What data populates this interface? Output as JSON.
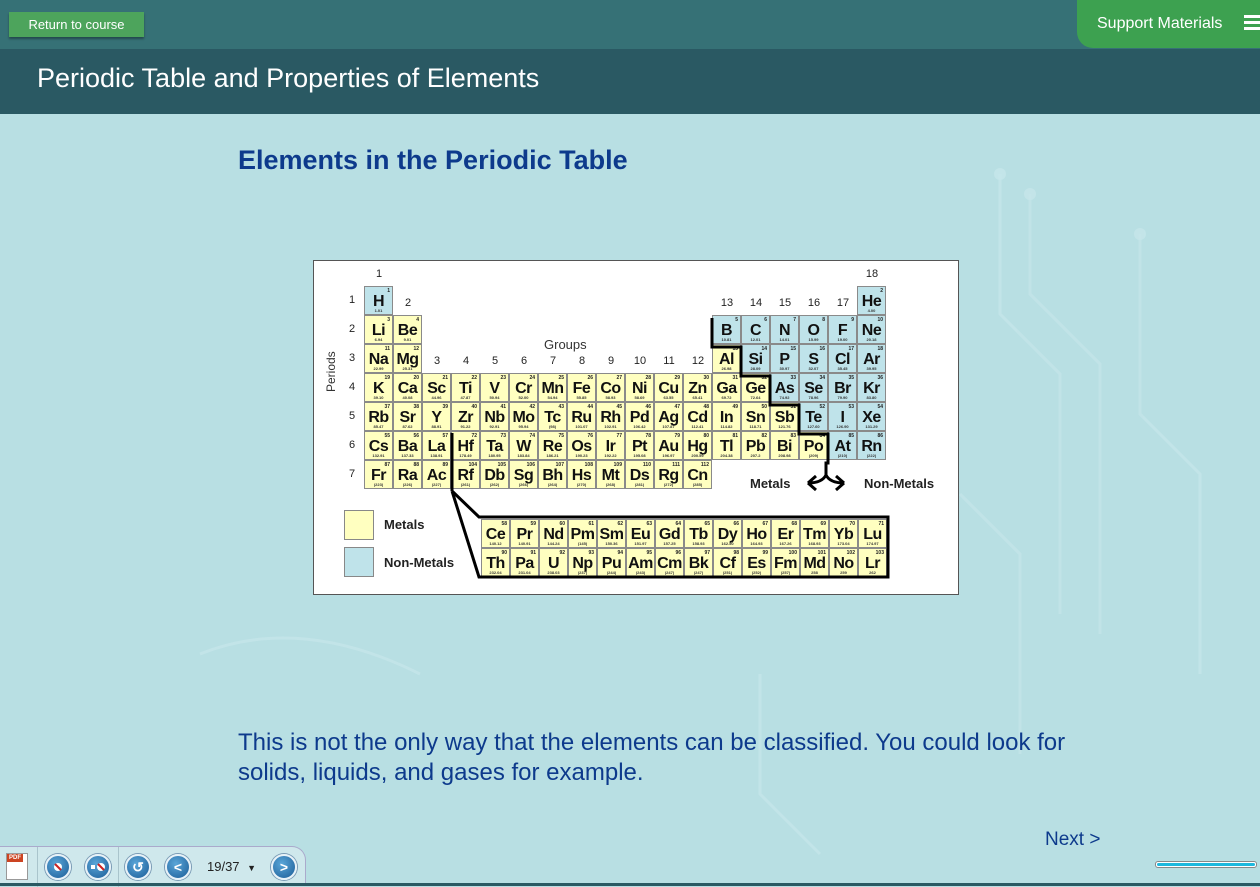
{
  "topbar": {
    "return_label": "Return to course",
    "support_label": "Support Materials"
  },
  "title": "Periodic Table and Properties of Elements",
  "heading": "Elements in the Periodic Table",
  "figure": {
    "groups_label": "Groups",
    "periods_label": "Periods",
    "group_labels": [
      "1",
      "2",
      "3",
      "4",
      "5",
      "6",
      "7",
      "8",
      "9",
      "10",
      "11",
      "12",
      "13",
      "14",
      "15",
      "16",
      "17",
      "18"
    ],
    "period_labels": [
      "1",
      "2",
      "3",
      "4",
      "5",
      "6",
      "7"
    ],
    "legend": [
      {
        "label": "Metals",
        "color": "#ffffc0"
      },
      {
        "label": "Non-Metals",
        "color": "#bfe3ea"
      }
    ],
    "divider_labels": {
      "left": "Metals",
      "right": "Non-Metals"
    },
    "elements": [
      {
        "s": "H",
        "n": 1,
        "m": "1.01",
        "r": 1,
        "c": 1,
        "t": "n"
      },
      {
        "s": "He",
        "n": 2,
        "m": "4.00",
        "r": 1,
        "c": 18,
        "t": "n"
      },
      {
        "s": "Li",
        "n": 3,
        "m": "6.94",
        "r": 2,
        "c": 1,
        "t": "m"
      },
      {
        "s": "Be",
        "n": 4,
        "m": "9.01",
        "r": 2,
        "c": 2,
        "t": "m"
      },
      {
        "s": "B",
        "n": 5,
        "m": "10.81",
        "r": 2,
        "c": 13,
        "t": "n"
      },
      {
        "s": "C",
        "n": 6,
        "m": "12.01",
        "r": 2,
        "c": 14,
        "t": "n"
      },
      {
        "s": "N",
        "n": 7,
        "m": "14.01",
        "r": 2,
        "c": 15,
        "t": "n"
      },
      {
        "s": "O",
        "n": 8,
        "m": "15.99",
        "r": 2,
        "c": 16,
        "t": "n"
      },
      {
        "s": "F",
        "n": 9,
        "m": "19.00",
        "r": 2,
        "c": 17,
        "t": "n"
      },
      {
        "s": "Ne",
        "n": 10,
        "m": "20.18",
        "r": 2,
        "c": 18,
        "t": "n"
      },
      {
        "s": "Na",
        "n": 11,
        "m": "22.99",
        "r": 3,
        "c": 1,
        "t": "m"
      },
      {
        "s": "Mg",
        "n": 12,
        "m": "25.31",
        "r": 3,
        "c": 2,
        "t": "m"
      },
      {
        "s": "Al",
        "n": 13,
        "m": "26.98",
        "r": 3,
        "c": 13,
        "t": "m"
      },
      {
        "s": "Si",
        "n": 14,
        "m": "28.09",
        "r": 3,
        "c": 14,
        "t": "n"
      },
      {
        "s": "P",
        "n": 15,
        "m": "30.97",
        "r": 3,
        "c": 15,
        "t": "n"
      },
      {
        "s": "S",
        "n": 16,
        "m": "32.07",
        "r": 3,
        "c": 16,
        "t": "n"
      },
      {
        "s": "Cl",
        "n": 17,
        "m": "35.45",
        "r": 3,
        "c": 17,
        "t": "n"
      },
      {
        "s": "Ar",
        "n": 18,
        "m": "39.95",
        "r": 3,
        "c": 18,
        "t": "n"
      },
      {
        "s": "K",
        "n": 19,
        "m": "39.10",
        "r": 4,
        "c": 1,
        "t": "m"
      },
      {
        "s": "Ca",
        "n": 20,
        "m": "40.08",
        "r": 4,
        "c": 2,
        "t": "m"
      },
      {
        "s": "Sc",
        "n": 21,
        "m": "44.96",
        "r": 4,
        "c": 3,
        "t": "m"
      },
      {
        "s": "Ti",
        "n": 22,
        "m": "47.87",
        "r": 4,
        "c": 4,
        "t": "m"
      },
      {
        "s": "V",
        "n": 23,
        "m": "50.94",
        "r": 4,
        "c": 5,
        "t": "m"
      },
      {
        "s": "Cr",
        "n": 24,
        "m": "52.00",
        "r": 4,
        "c": 6,
        "t": "m"
      },
      {
        "s": "Mn",
        "n": 25,
        "m": "54.94",
        "r": 4,
        "c": 7,
        "t": "m"
      },
      {
        "s": "Fe",
        "n": 26,
        "m": "55.85",
        "r": 4,
        "c": 8,
        "t": "m"
      },
      {
        "s": "Co",
        "n": 27,
        "m": "58.93",
        "r": 4,
        "c": 9,
        "t": "m"
      },
      {
        "s": "Ni",
        "n": 28,
        "m": "58.69",
        "r": 4,
        "c": 10,
        "t": "m"
      },
      {
        "s": "Cu",
        "n": 29,
        "m": "63.55",
        "r": 4,
        "c": 11,
        "t": "m"
      },
      {
        "s": "Zn",
        "n": 30,
        "m": "65.41",
        "r": 4,
        "c": 12,
        "t": "m"
      },
      {
        "s": "Ga",
        "n": 31,
        "m": "69.72",
        "r": 4,
        "c": 13,
        "t": "m"
      },
      {
        "s": "Ge",
        "n": 32,
        "m": "72.64",
        "r": 4,
        "c": 14,
        "t": "m"
      },
      {
        "s": "As",
        "n": 33,
        "m": "74.92",
        "r": 4,
        "c": 15,
        "t": "n"
      },
      {
        "s": "Se",
        "n": 34,
        "m": "78.96",
        "r": 4,
        "c": 16,
        "t": "n"
      },
      {
        "s": "Br",
        "n": 35,
        "m": "79.90",
        "r": 4,
        "c": 17,
        "t": "n"
      },
      {
        "s": "Kr",
        "n": 36,
        "m": "83.80",
        "r": 4,
        "c": 18,
        "t": "n"
      },
      {
        "s": "Rb",
        "n": 37,
        "m": "85.47",
        "r": 5,
        "c": 1,
        "t": "m"
      },
      {
        "s": "Sr",
        "n": 38,
        "m": "87.62",
        "r": 5,
        "c": 2,
        "t": "m"
      },
      {
        "s": "Y",
        "n": 39,
        "m": "88.91",
        "r": 5,
        "c": 3,
        "t": "m"
      },
      {
        "s": "Zr",
        "n": 40,
        "m": "91.22",
        "r": 5,
        "c": 4,
        "t": "m"
      },
      {
        "s": "Nb",
        "n": 41,
        "m": "92.91",
        "r": 5,
        "c": 5,
        "t": "m"
      },
      {
        "s": "Mo",
        "n": 42,
        "m": "95.94",
        "r": 5,
        "c": 6,
        "t": "m"
      },
      {
        "s": "Tc",
        "n": 43,
        "m": "(98)",
        "r": 5,
        "c": 7,
        "t": "m"
      },
      {
        "s": "Ru",
        "n": 44,
        "m": "101.07",
        "r": 5,
        "c": 8,
        "t": "m"
      },
      {
        "s": "Rh",
        "n": 45,
        "m": "102.91",
        "r": 5,
        "c": 9,
        "t": "m"
      },
      {
        "s": "Pd",
        "n": 46,
        "m": "106.42",
        "r": 5,
        "c": 10,
        "t": "m"
      },
      {
        "s": "Ag",
        "n": 47,
        "m": "107.87",
        "r": 5,
        "c": 11,
        "t": "m"
      },
      {
        "s": "Cd",
        "n": 48,
        "m": "112.41",
        "r": 5,
        "c": 12,
        "t": "m"
      },
      {
        "s": "In",
        "n": 49,
        "m": "114.82",
        "r": 5,
        "c": 13,
        "t": "m"
      },
      {
        "s": "Sn",
        "n": 50,
        "m": "118.71",
        "r": 5,
        "c": 14,
        "t": "m"
      },
      {
        "s": "Sb",
        "n": 51,
        "m": "121.76",
        "r": 5,
        "c": 15,
        "t": "m"
      },
      {
        "s": "Te",
        "n": 52,
        "m": "127.60",
        "r": 5,
        "c": 16,
        "t": "n"
      },
      {
        "s": "I",
        "n": 53,
        "m": "126.90",
        "r": 5,
        "c": 17,
        "t": "n"
      },
      {
        "s": "Xe",
        "n": 54,
        "m": "131.29",
        "r": 5,
        "c": 18,
        "t": "n"
      },
      {
        "s": "Cs",
        "n": 55,
        "m": "132.91",
        "r": 6,
        "c": 1,
        "t": "m"
      },
      {
        "s": "Ba",
        "n": 56,
        "m": "137.33",
        "r": 6,
        "c": 2,
        "t": "m"
      },
      {
        "s": "La",
        "n": 57,
        "m": "138.91",
        "r": 6,
        "c": 3,
        "t": "m"
      },
      {
        "s": "Hf",
        "n": 72,
        "m": "178.49",
        "r": 6,
        "c": 4,
        "t": "m"
      },
      {
        "s": "Ta",
        "n": 73,
        "m": "180.95",
        "r": 6,
        "c": 5,
        "t": "m"
      },
      {
        "s": "W",
        "n": 74,
        "m": "183.84",
        "r": 6,
        "c": 6,
        "t": "m"
      },
      {
        "s": "Re",
        "n": 75,
        "m": "186.21",
        "r": 6,
        "c": 7,
        "t": "m"
      },
      {
        "s": "Os",
        "n": 76,
        "m": "190.23",
        "r": 6,
        "c": 8,
        "t": "m"
      },
      {
        "s": "Ir",
        "n": 77,
        "m": "192.22",
        "r": 6,
        "c": 9,
        "t": "m"
      },
      {
        "s": "Pt",
        "n": 78,
        "m": "195.08",
        "r": 6,
        "c": 10,
        "t": "m"
      },
      {
        "s": "Au",
        "n": 79,
        "m": "196.97",
        "r": 6,
        "c": 11,
        "t": "m"
      },
      {
        "s": "Hg",
        "n": 80,
        "m": "200.59",
        "r": 6,
        "c": 12,
        "t": "m"
      },
      {
        "s": "Tl",
        "n": 81,
        "m": "204.38",
        "r": 6,
        "c": 13,
        "t": "m"
      },
      {
        "s": "Pb",
        "n": 82,
        "m": "207.2",
        "r": 6,
        "c": 14,
        "t": "m"
      },
      {
        "s": "Bi",
        "n": 83,
        "m": "208.98",
        "r": 6,
        "c": 15,
        "t": "m"
      },
      {
        "s": "Po",
        "n": 84,
        "m": "(209)",
        "r": 6,
        "c": 16,
        "t": "m"
      },
      {
        "s": "At",
        "n": 85,
        "m": "(210)",
        "r": 6,
        "c": 17,
        "t": "n"
      },
      {
        "s": "Rn",
        "n": 86,
        "m": "(222)",
        "r": 6,
        "c": 18,
        "t": "n"
      },
      {
        "s": "Fr",
        "n": 87,
        "m": "(223)",
        "r": 7,
        "c": 1,
        "t": "m"
      },
      {
        "s": "Ra",
        "n": 88,
        "m": "(226)",
        "r": 7,
        "c": 2,
        "t": "m"
      },
      {
        "s": "Ac",
        "n": 89,
        "m": "(227)",
        "r": 7,
        "c": 3,
        "t": "m"
      },
      {
        "s": "Rf",
        "n": 104,
        "m": "(261)",
        "r": 7,
        "c": 4,
        "t": "m"
      },
      {
        "s": "Db",
        "n": 105,
        "m": "(262)",
        "r": 7,
        "c": 5,
        "t": "m"
      },
      {
        "s": "Sg",
        "n": 106,
        "m": "(266)",
        "r": 7,
        "c": 6,
        "t": "m"
      },
      {
        "s": "Bh",
        "n": 107,
        "m": "(264)",
        "r": 7,
        "c": 7,
        "t": "m"
      },
      {
        "s": "Hs",
        "n": 108,
        "m": "(270)",
        "r": 7,
        "c": 8,
        "t": "m"
      },
      {
        "s": "Mt",
        "n": 109,
        "m": "(268)",
        "r": 7,
        "c": 9,
        "t": "m"
      },
      {
        "s": "Ds",
        "n": 110,
        "m": "(281)",
        "r": 7,
        "c": 10,
        "t": "m"
      },
      {
        "s": "Rg",
        "n": 111,
        "m": "(272)",
        "r": 7,
        "c": 11,
        "t": "m"
      },
      {
        "s": "Cn",
        "n": 112,
        "m": "(285)",
        "r": 7,
        "c": 12,
        "t": "m"
      }
    ],
    "f_block": [
      [
        {
          "s": "Ce",
          "n": 58,
          "m": "140.12"
        },
        {
          "s": "Pr",
          "n": 59,
          "m": "140.91"
        },
        {
          "s": "Nd",
          "n": 60,
          "m": "144.24"
        },
        {
          "s": "Pm",
          "n": 61,
          "m": "(145)"
        },
        {
          "s": "Sm",
          "n": 62,
          "m": "150.36"
        },
        {
          "s": "Eu",
          "n": 63,
          "m": "151.97"
        },
        {
          "s": "Gd",
          "n": 64,
          "m": "157.25"
        },
        {
          "s": "Tb",
          "n": 65,
          "m": "158.93"
        },
        {
          "s": "Dy",
          "n": 66,
          "m": "162.50"
        },
        {
          "s": "Ho",
          "n": 67,
          "m": "164.93"
        },
        {
          "s": "Er",
          "n": 68,
          "m": "167.26"
        },
        {
          "s": "Tm",
          "n": 69,
          "m": "168.93"
        },
        {
          "s": "Yb",
          "n": 70,
          "m": "173.04"
        },
        {
          "s": "Lu",
          "n": 71,
          "m": "174.97"
        }
      ],
      [
        {
          "s": "Th",
          "n": 90,
          "m": "232.04"
        },
        {
          "s": "Pa",
          "n": 91,
          "m": "231.04"
        },
        {
          "s": "U",
          "n": 92,
          "m": "238.03"
        },
        {
          "s": "Np",
          "n": 93,
          "m": "(237)"
        },
        {
          "s": "Pu",
          "n": 94,
          "m": "(244)"
        },
        {
          "s": "Am",
          "n": 95,
          "m": "(243)"
        },
        {
          "s": "Cm",
          "n": 96,
          "m": "(247)"
        },
        {
          "s": "Bk",
          "n": 97,
          "m": "(247)"
        },
        {
          "s": "Cf",
          "n": 98,
          "m": "(251)"
        },
        {
          "s": "Es",
          "n": 99,
          "m": "(252)"
        },
        {
          "s": "Fm",
          "n": 100,
          "m": "(257)"
        },
        {
          "s": "Md",
          "n": 101,
          "m": "258"
        },
        {
          "s": "No",
          "n": 102,
          "m": "259"
        },
        {
          "s": "Lr",
          "n": 103,
          "m": "262"
        }
      ]
    ]
  },
  "body_text": "This is not the only way that the elements can be classified. You could look for solids, liquids, and gases for example.",
  "next_label": "Next >",
  "progress": {
    "fraction": 1.0
  },
  "toolbar": {
    "page_indicator": "19/37",
    "dropdown_glyph": "▼",
    "pdf_tag": "PDF"
  }
}
